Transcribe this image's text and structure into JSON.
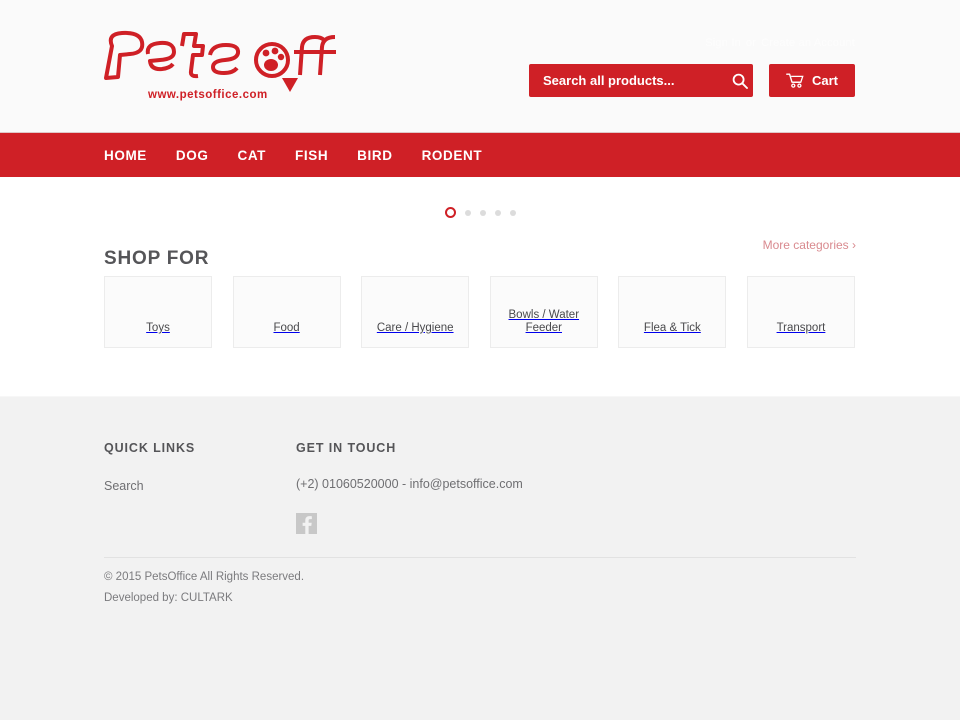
{
  "site": {
    "brand_name": "Petsoffice",
    "logo_text": "Petsoffice",
    "logo_url_text": "www.petsoffice.com",
    "accent_color": "#cf2026",
    "header_bg": "#fafafa",
    "footer_bg": "#f2f2f2"
  },
  "header": {
    "account": {
      "sign_in_label": "Sign In",
      "separator": "or",
      "create_account_label": "Create an Account"
    },
    "search": {
      "placeholder": "Search all products...",
      "value": "",
      "icon": "search-icon"
    },
    "cart": {
      "label": "Cart",
      "icon": "shopping-cart-icon"
    }
  },
  "nav": {
    "items": [
      {
        "label": "HOME"
      },
      {
        "label": "DOG"
      },
      {
        "label": "CAT"
      },
      {
        "label": "FISH"
      },
      {
        "label": "BIRD"
      },
      {
        "label": "RODENT"
      }
    ]
  },
  "slider": {
    "dot_count": 5,
    "active_index": 0,
    "active_color": "#cf2026",
    "inactive_color": "#dcdcdc"
  },
  "shop_for": {
    "title": "SHOP FOR",
    "more_label": "More categories ›",
    "categories": [
      {
        "label": "Toys"
      },
      {
        "label": "Food"
      },
      {
        "label": "Care / Hygiene"
      },
      {
        "label": "Bowls / Water Feeder"
      },
      {
        "label": "Flea & Tick"
      },
      {
        "label": "Transport"
      }
    ]
  },
  "footer": {
    "quick_links": {
      "heading": "QUICK LINKS",
      "links": [
        {
          "label": "Search"
        }
      ]
    },
    "get_in_touch": {
      "heading": "GET IN TOUCH",
      "contact": "(+2) 01060520000 - info@petsoffice.com",
      "social": [
        {
          "name": "facebook-icon",
          "label": "f"
        }
      ]
    },
    "copyright": "© 2015 PetsOffice All Rights Reserved.",
    "developed_by": "Developed by: CULTARK"
  }
}
